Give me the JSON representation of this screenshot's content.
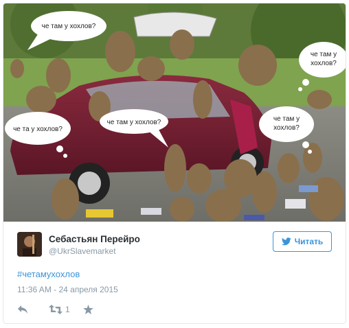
{
  "tweet": {
    "author_name": "Себастьян Перейро",
    "author_handle": "@UkrSlavemarket",
    "follow_label": "Читать",
    "hashtag": "#четамухохлов",
    "timestamp": "11:36 AM - 24 апреля 2015",
    "retweet_count": "1"
  },
  "image": {
    "bubbles": [
      "че там у хохлов?",
      "че там у",
      "хохлов?",
      "че та у хохлов?",
      "че там у хохлов?",
      "че там у",
      "хохлов?"
    ]
  },
  "icons": {
    "reply": "reply-icon",
    "retweet": "retweet-icon",
    "like": "star-icon",
    "follow": "bird-icon"
  },
  "colors": {
    "link": "#3b94d9",
    "muted": "#8899a6",
    "border": "#e1e8ed"
  }
}
